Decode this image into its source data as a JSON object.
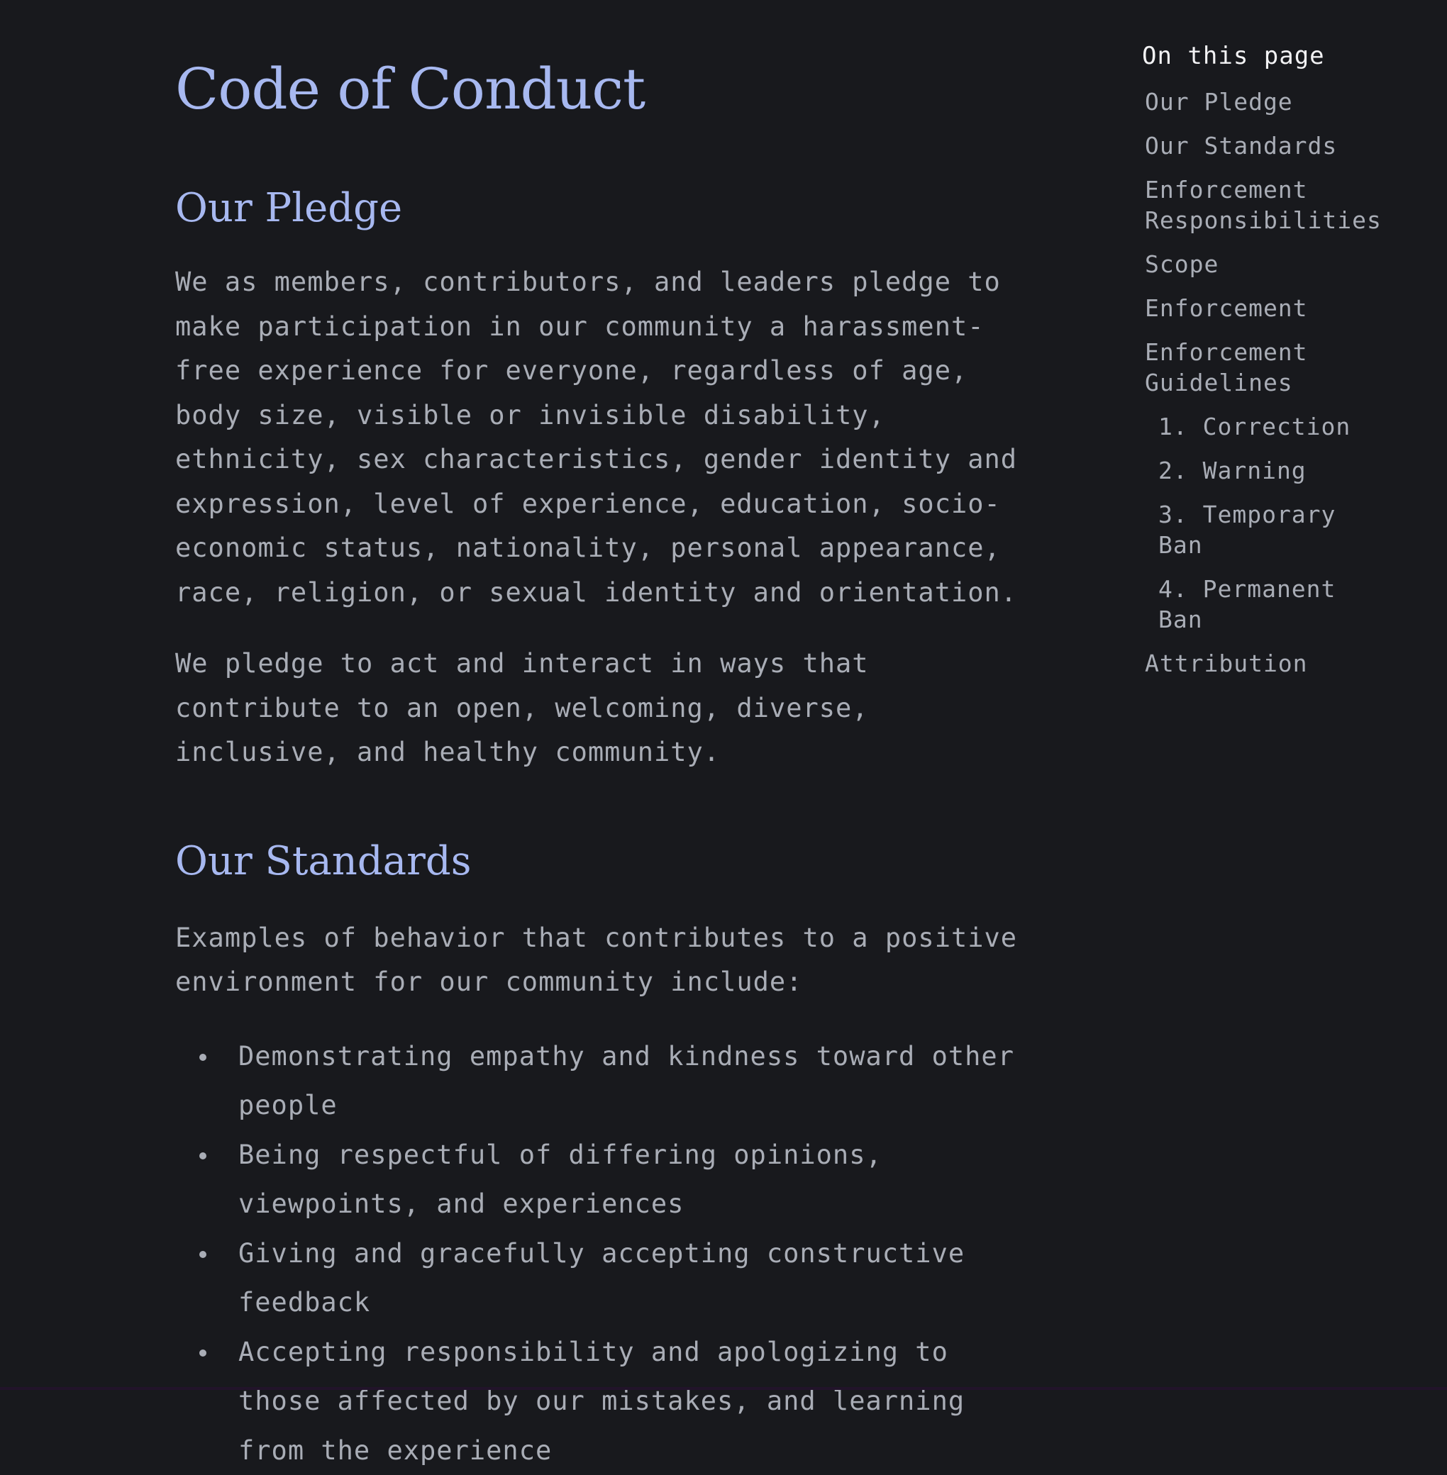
{
  "page": {
    "title": "Code of Conduct"
  },
  "sections": {
    "pledge": {
      "heading": "Our Pledge",
      "paragraphs": [
        "We as members, contributors, and leaders pledge to make participation in our community a harassment-free experience for everyone, regardless of age, body size, visible or invisible disability, ethnicity, sex characteristics, gender identity and expression, level of experience, education, socio-economic status, nationality, personal appearance, race, religion, or sexual identity and orientation.",
        "We pledge to act and interact in ways that contribute to an open, welcoming, diverse, inclusive, and healthy community."
      ]
    },
    "standards": {
      "heading": "Our Standards",
      "intro": "Examples of behavior that contributes to a positive environment for our community include:",
      "bullets": [
        "Demonstrating empathy and kindness toward other people",
        "Being respectful of differing opinions, viewpoints, and experiences",
        "Giving and gracefully accepting constructive feedback",
        "Accepting responsibility and apologizing to those affected by our mistakes, and learning from the experience"
      ]
    }
  },
  "toc": {
    "title": "On this page",
    "items": [
      "Our Pledge",
      "Our Standards",
      "Enforcement Responsibilities",
      "Scope",
      "Enforcement",
      "Enforcement Guidelines",
      "1. Correction",
      "2. Warning",
      "3. Temporary Ban",
      "4. Permanent Ban",
      "Attribution"
    ]
  },
  "colors": {
    "background": "#18191d",
    "heading": "#a7b8f0",
    "body_text": "#a9adb6",
    "toc_title": "#f2f2f4"
  }
}
